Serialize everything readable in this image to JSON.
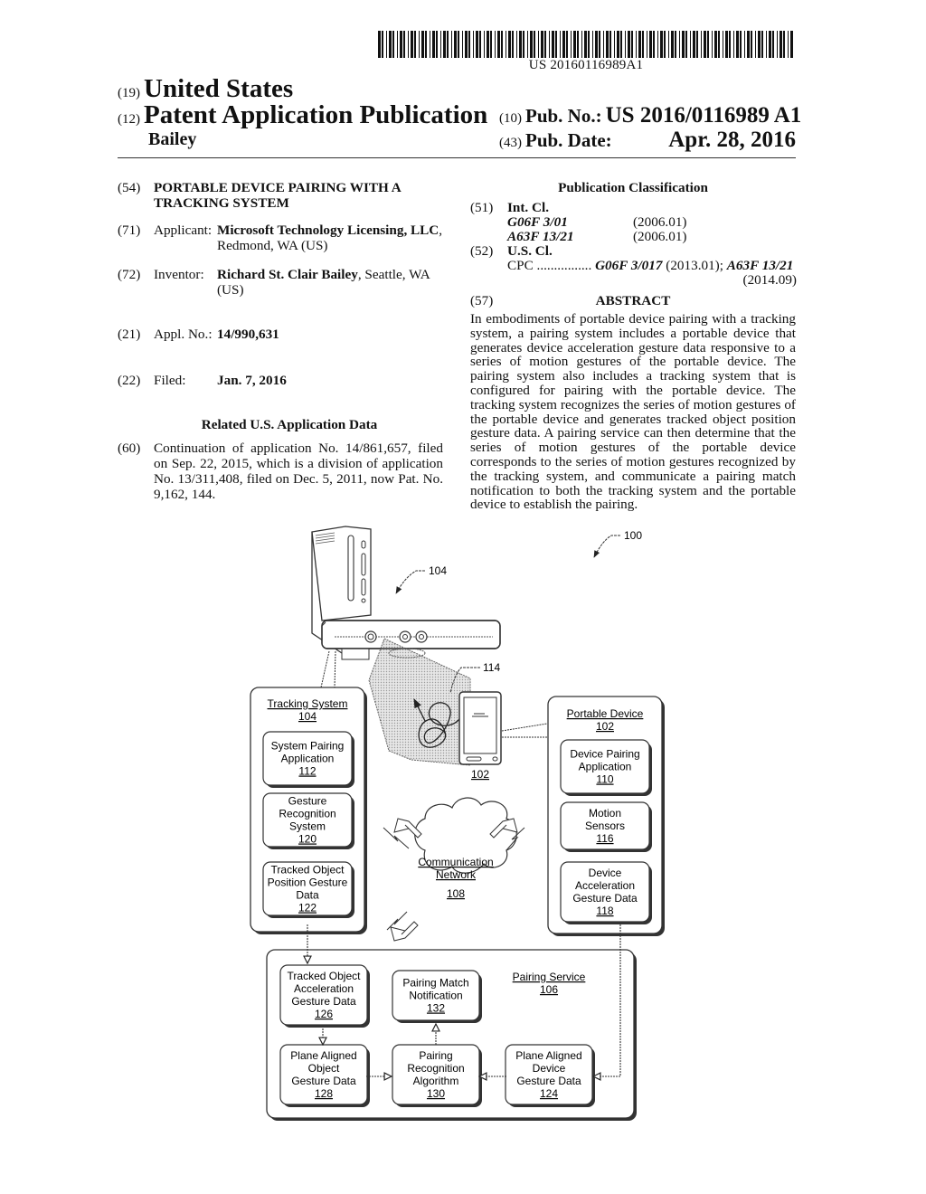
{
  "barcode": {
    "number": "US 20160116989A1"
  },
  "header": {
    "country_code": "(19)",
    "country": "United States",
    "doctype_code": "(12)",
    "doctype": "Patent Application Publication",
    "inventor_surname": "Bailey",
    "pub_no_code": "(10)",
    "pub_no_label": "Pub. No.:",
    "pub_no": "US 2016/0116989 A1",
    "pub_date_code": "(43)",
    "pub_date_label": "Pub. Date:",
    "pub_date": "Apr. 28, 2016"
  },
  "biblio": {
    "title": {
      "code": "(54)",
      "value": "PORTABLE DEVICE PAIRING WITH A TRACKING SYSTEM"
    },
    "applicant": {
      "code": "(71)",
      "label": "Applicant:",
      "name": "Microsoft Technology Licensing, LLC",
      "location": ", Redmond, WA (US)"
    },
    "inventor": {
      "code": "(72)",
      "label": "Inventor:",
      "name": "Richard St. Clair Bailey",
      "location": ", Seattle, WA (US)"
    },
    "appl_no": {
      "code": "(21)",
      "label": "Appl. No.:",
      "value": "14/990,631"
    },
    "filed": {
      "code": "(22)",
      "label": "Filed:",
      "value": "Jan. 7, 2016"
    },
    "related_title": "Related U.S. Application Data",
    "related": {
      "code": "(60)",
      "value": "Continuation of application No. 14/861,657, filed on Sep. 22, 2015, which is a division of application No. 13/311,408, filed on Dec. 5, 2011, now Pat. No. 9,162, 144."
    }
  },
  "classification": {
    "title": "Publication Classification",
    "int_cl": {
      "code": "(51)",
      "label": "Int. Cl.",
      "entries": [
        {
          "class": "G06F 3/01",
          "version": "(2006.01)"
        },
        {
          "class": "A63F 13/21",
          "version": "(2006.01)"
        }
      ]
    },
    "us_cl": {
      "code": "(52)",
      "label": "U.S. Cl.",
      "cpc_label": "CPC",
      "cpc_dots": "................",
      "cpc_1": "G06F 3/017",
      "cpc_1_ver": "(2013.01);",
      "cpc_2": "A63F 13/21",
      "cpc_2_ver": "(2014.09)"
    }
  },
  "abstract": {
    "code": "(57)",
    "title": "ABSTRACT",
    "body": "In embodiments of portable device pairing with a tracking system, a pairing system includes a portable device that generates device acceleration gesture data responsive to a series of motion gestures of the portable device. The pairing system also includes a tracking system that is configured for pairing with the portable device. The tracking system recognizes the series of motion gestures of the portable device and generates tracked object position gesture data. A pairing service can then determine that the series of motion gestures of the portable device corresponds to the series of motion gestures recognized by the tracking system, and communicate a pairing match notification to both the tracking system and the portable device to establish the pairing."
  },
  "figure": {
    "ref_system": "100",
    "ref_tracking_hw": "104",
    "ref_gesture": "114",
    "ref_phone": "102",
    "tracking_system": {
      "title": "Tracking System",
      "ref": "104",
      "boxes": [
        {
          "lines": [
            "System Pairing",
            "Application"
          ],
          "ref": "112"
        },
        {
          "lines": [
            "Gesture",
            "Recognition",
            "System"
          ],
          "ref": "120"
        },
        {
          "lines": [
            "Tracked Object",
            "Position Gesture",
            "Data"
          ],
          "ref": "122"
        }
      ]
    },
    "portable_device": {
      "title": "Portable Device",
      "ref": "102",
      "boxes": [
        {
          "lines": [
            "Device Pairing",
            "Application"
          ],
          "ref": "110"
        },
        {
          "lines": [
            "Motion",
            "Sensors"
          ],
          "ref": "116"
        },
        {
          "lines": [
            "Device",
            "Acceleration",
            "Gesture Data"
          ],
          "ref": "118"
        }
      ]
    },
    "network": {
      "lines": [
        "Communication",
        "Network"
      ],
      "ref": "108"
    },
    "pairing_service": {
      "title": "Pairing Service",
      "ref": "106",
      "boxes": [
        {
          "lines": [
            "Tracked Object",
            "Acceleration",
            "Gesture Data"
          ],
          "ref": "126"
        },
        {
          "lines": [
            "Pairing Match",
            "Notification"
          ],
          "ref": "132"
        },
        {
          "lines": [
            "Plane Aligned",
            "Object",
            "Gesture Data"
          ],
          "ref": "128"
        },
        {
          "lines": [
            "Pairing",
            "Recognition",
            "Algorithm"
          ],
          "ref": "130"
        },
        {
          "lines": [
            "Plane Aligned",
            "Device",
            "Gesture Data"
          ],
          "ref": "124"
        }
      ]
    }
  }
}
